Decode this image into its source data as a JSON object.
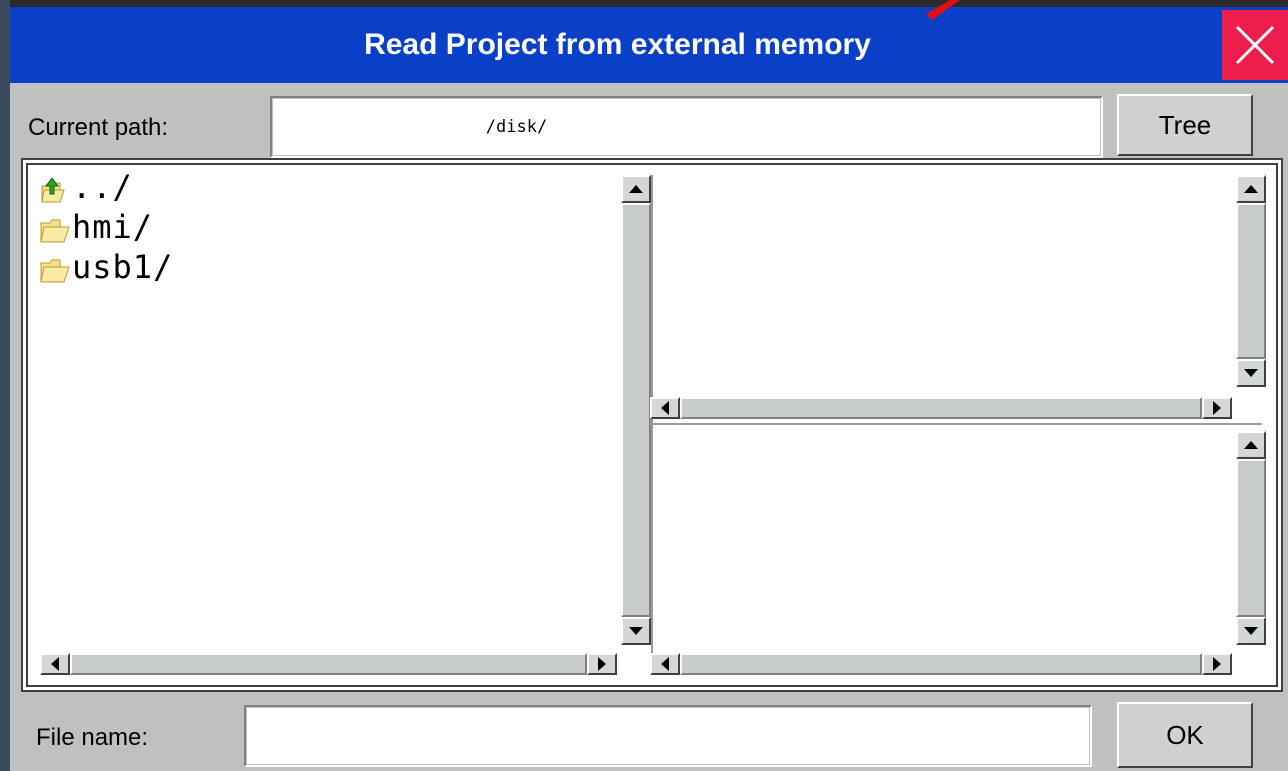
{
  "window": {
    "title": "Read Project from external memory",
    "close_icon": "close-x-icon",
    "title_bar_color": "#0a3fc8",
    "close_button_color": "#ee1d4b"
  },
  "path": {
    "label": "Current path:",
    "value": "/disk/",
    "tree_button": "Tree"
  },
  "file_list": {
    "items": [
      {
        "name": "../",
        "icon": "parent-folder-icon"
      },
      {
        "name": "hmi/",
        "icon": "folder-icon"
      },
      {
        "name": "usb1/",
        "icon": "folder-icon"
      }
    ]
  },
  "footer": {
    "file_name_label": "File name:",
    "file_name_value": "",
    "ok_button": "OK"
  }
}
